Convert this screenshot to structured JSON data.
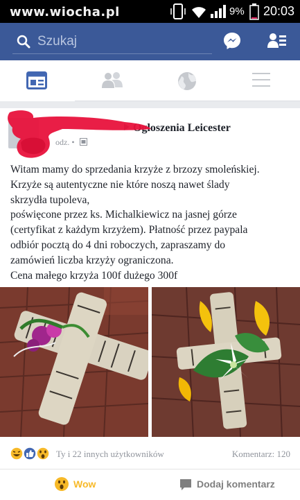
{
  "status_bar": {
    "watermark": "www.wiocha.pl",
    "battery_percent": "9%",
    "time": "20:03",
    "icons": [
      "phone-vibrate-icon",
      "wifi-icon",
      "signal-icon",
      "battery-icon"
    ]
  },
  "search_bar": {
    "placeholder": "Szukaj",
    "icons": [
      "search-icon",
      "messenger-icon",
      "friend-requests-icon"
    ]
  },
  "nav_tabs": [
    {
      "name": "news-feed-icon",
      "active": true
    },
    {
      "name": "friends-icon",
      "active": false
    },
    {
      "name": "globe-icon",
      "active": false
    },
    {
      "name": "menu-icon",
      "active": false
    }
  ],
  "post": {
    "group_name": "Ogloszenia Leicester",
    "meta": "odz. •",
    "text_lines": [
      "Witam mamy do sprzedania krzyże z brzozy smoleńskiej.",
      "Krzyże są autentyczne nie które noszą nawet ślady",
      "skrzydła tupoleva,",
      "poświęcone przez ks. Michalkiewicz na jasnej górze",
      "(certyfikat z każdym krzyżem). Płatność przez paypala",
      "odbiór pocztą do 4 dni roboczych, zapraszamy do",
      "zamówień liczba krzyży ograniczona.",
      "Cena małego krzyża 100f dużego 300f"
    ],
    "reactions_text": "Ty i 22 innych użytkowników",
    "reaction_icons": [
      "haha-icon",
      "like-icon",
      "wow-icon"
    ],
    "comments_text": "Komentarz: 120",
    "actions": {
      "wow_label": "Wow",
      "comment_label": "Dodaj komentarz"
    }
  },
  "colors": {
    "facebook_blue": "#3b5998",
    "wow_yellow": "#f7b928",
    "scribble_red": "#e8123c"
  }
}
